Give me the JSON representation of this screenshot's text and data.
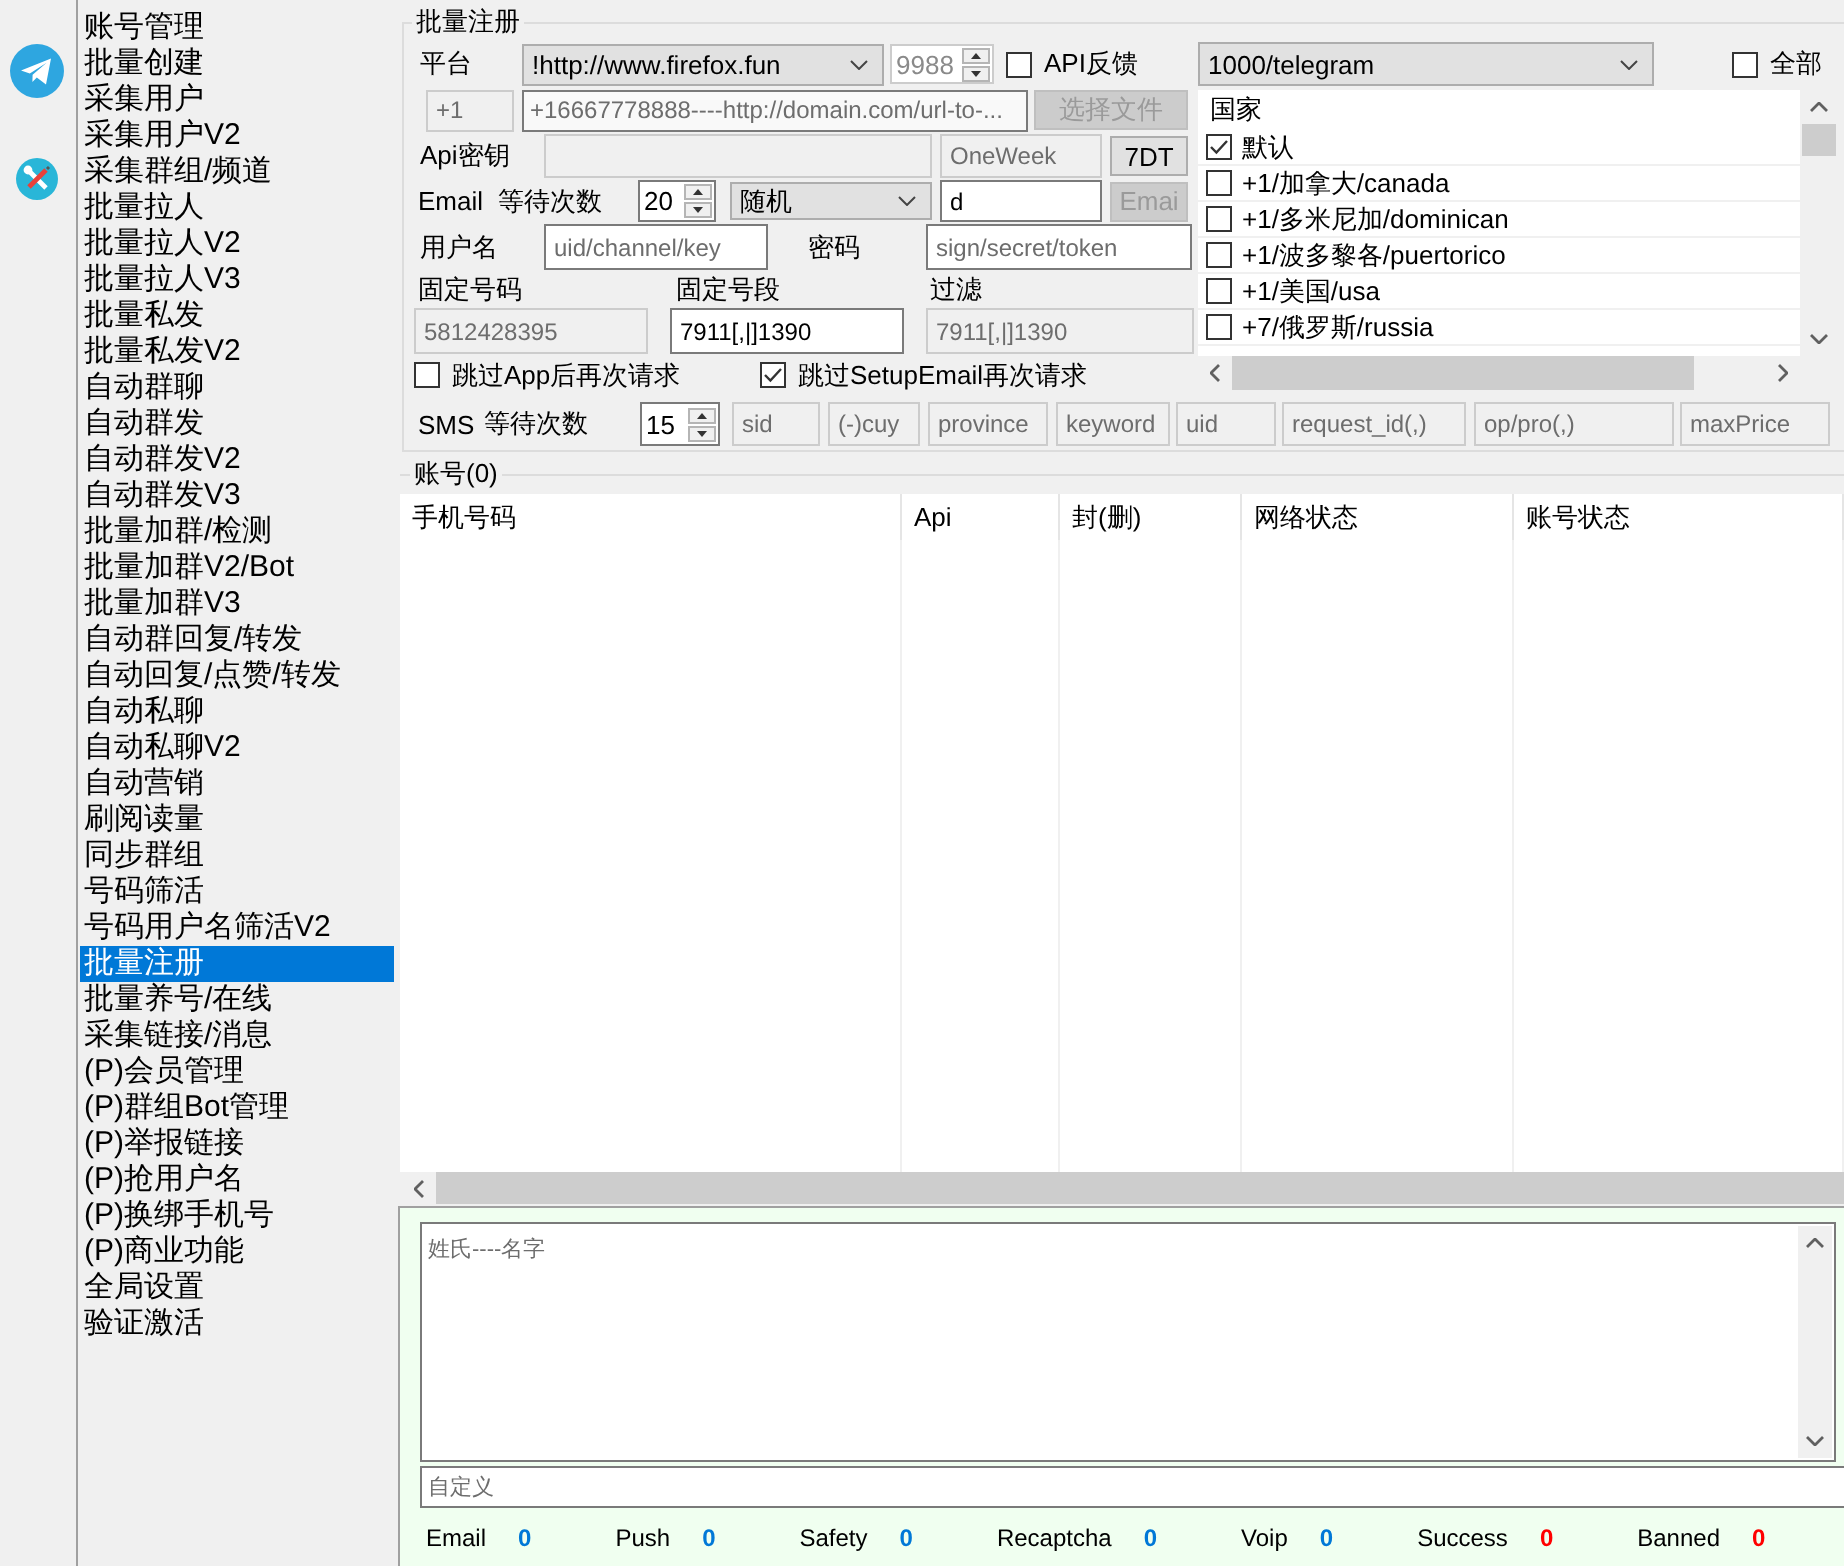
{
  "sidebar": {
    "items": [
      {
        "label": "账号管理",
        "selected": false
      },
      {
        "label": "批量创建",
        "selected": false
      },
      {
        "label": "采集用户",
        "selected": false
      },
      {
        "label": "采集用户V2",
        "selected": false
      },
      {
        "label": "采集群组/频道",
        "selected": false
      },
      {
        "label": "批量拉人",
        "selected": false
      },
      {
        "label": "批量拉人V2",
        "selected": false
      },
      {
        "label": "批量拉人V3",
        "selected": false
      },
      {
        "label": "批量私发",
        "selected": false
      },
      {
        "label": "批量私发V2",
        "selected": false
      },
      {
        "label": "自动群聊",
        "selected": false
      },
      {
        "label": "自动群发",
        "selected": false
      },
      {
        "label": "自动群发V2",
        "selected": false
      },
      {
        "label": "自动群发V3",
        "selected": false
      },
      {
        "label": "批量加群/检测",
        "selected": false
      },
      {
        "label": "批量加群V2/Bot",
        "selected": false
      },
      {
        "label": "批量加群V3",
        "selected": false
      },
      {
        "label": "自动群回复/转发",
        "selected": false
      },
      {
        "label": "自动回复/点赞/转发",
        "selected": false
      },
      {
        "label": "自动私聊",
        "selected": false
      },
      {
        "label": "自动私聊V2",
        "selected": false
      },
      {
        "label": "自动营销",
        "selected": false
      },
      {
        "label": "刷阅读量",
        "selected": false
      },
      {
        "label": "同步群组",
        "selected": false
      },
      {
        "label": "号码筛活",
        "selected": false
      },
      {
        "label": "号码用户名筛活V2",
        "selected": false
      },
      {
        "label": "批量注册",
        "selected": true
      },
      {
        "label": "批量养号/在线",
        "selected": false
      },
      {
        "label": "采集链接/消息",
        "selected": false
      },
      {
        "label": "(P)会员管理",
        "selected": false
      },
      {
        "label": "(P)群组Bot管理",
        "selected": false
      },
      {
        "label": "(P)举报链接",
        "selected": false
      },
      {
        "label": "(P)抢用户名",
        "selected": false
      },
      {
        "label": "(P)换绑手机号",
        "selected": false
      },
      {
        "label": "(P)商业功能",
        "selected": false
      },
      {
        "label": "全局设置",
        "selected": false
      },
      {
        "label": "验证激活",
        "selected": false
      }
    ]
  },
  "register": {
    "title": "批量注册",
    "platform": {
      "label": "平台",
      "value": "!http://www.firefox.fun",
      "port": {
        "value": "9988",
        "disabled": true
      },
      "api_feedback": {
        "label": "API反馈",
        "checked": false
      }
    },
    "service": {
      "value": "1000/telegram",
      "select_all": {
        "label": "全部",
        "checked": false
      }
    },
    "prefix": {
      "value": "+1",
      "disabled": true
    },
    "number_source": {
      "placeholder": "+16667778888----http://domain.com/url-to-..."
    },
    "choose_file": {
      "label": "选择文件",
      "disabled": true
    },
    "countries": {
      "header": "国家",
      "items": [
        {
          "label": "默认",
          "checked": true
        },
        {
          "label": "+1/加拿大/canada",
          "checked": false
        },
        {
          "label": "+1/多米尼加/dominican",
          "checked": false
        },
        {
          "label": "+1/波多黎各/puertorico",
          "checked": false
        },
        {
          "label": "+1/美国/usa",
          "checked": false
        },
        {
          "label": "+7/俄罗斯/russia",
          "checked": false
        }
      ]
    },
    "api_key": {
      "label": "Api密钥",
      "disabled": true
    },
    "duration": {
      "value": "OneWeek",
      "disabled": true
    },
    "duration_button": {
      "label": "7DT",
      "disabled": false
    },
    "email": {
      "label": "Email",
      "wait_label": "等待次数",
      "wait": "20",
      "mode": "随机",
      "value": "d",
      "button": {
        "label": "Emai",
        "disabled": true
      }
    },
    "username": {
      "label": "用户名",
      "placeholder": "uid/channel/key"
    },
    "password": {
      "label": "密码",
      "placeholder": "sign/secret/token"
    },
    "number_fields": [
      {
        "label": "固定号码",
        "value": "5812428395",
        "disabled": true
      },
      {
        "label": "固定号段",
        "value": "7911[,|]1390",
        "disabled": false
      },
      {
        "label": "过滤",
        "value": "7911[,|]1390",
        "disabled": true
      }
    ],
    "options": [
      {
        "label": "跳过App后再次请求",
        "checked": false
      },
      {
        "label": "跳过SetupEmail再次请求",
        "checked": true
      }
    ],
    "sms": {
      "label": "SMS",
      "wait_label": "等待次数",
      "wait": "15",
      "fields": [
        {
          "placeholder": "sid",
          "disabled": true
        },
        {
          "placeholder": "(-)cuy",
          "disabled": true
        },
        {
          "placeholder": "province",
          "disabled": true
        },
        {
          "placeholder": "keyword",
          "disabled": true
        },
        {
          "placeholder": "uid",
          "disabled": true
        },
        {
          "placeholder": "request_id(,)",
          "disabled": true
        },
        {
          "placeholder": "op/pro(,)",
          "disabled": true
        },
        {
          "placeholder": "maxPrice",
          "disabled": true
        }
      ]
    }
  },
  "accounts": {
    "title": "账号(0)",
    "columns": [
      "手机号码",
      "Api",
      "封(删)",
      "网络状态",
      "账号状态"
    ]
  },
  "log": {
    "names": {
      "placeholder": "姓氏----名字"
    },
    "custom": {
      "placeholder": "自定义"
    },
    "stats": [
      {
        "label": "Email",
        "value": "0",
        "color": "#0078d7"
      },
      {
        "label": "Push",
        "value": "0",
        "color": "#0078d7"
      },
      {
        "label": "Safety",
        "value": "0",
        "color": "#0078d7"
      },
      {
        "label": "Recaptcha",
        "value": "0",
        "color": "#0078d7"
      },
      {
        "label": "Voip",
        "value": "0",
        "color": "#0078d7"
      },
      {
        "label": "Success",
        "value": "0",
        "color": "#ff0000"
      },
      {
        "label": "Banned",
        "value": "0",
        "color": "#ff0000"
      }
    ]
  }
}
